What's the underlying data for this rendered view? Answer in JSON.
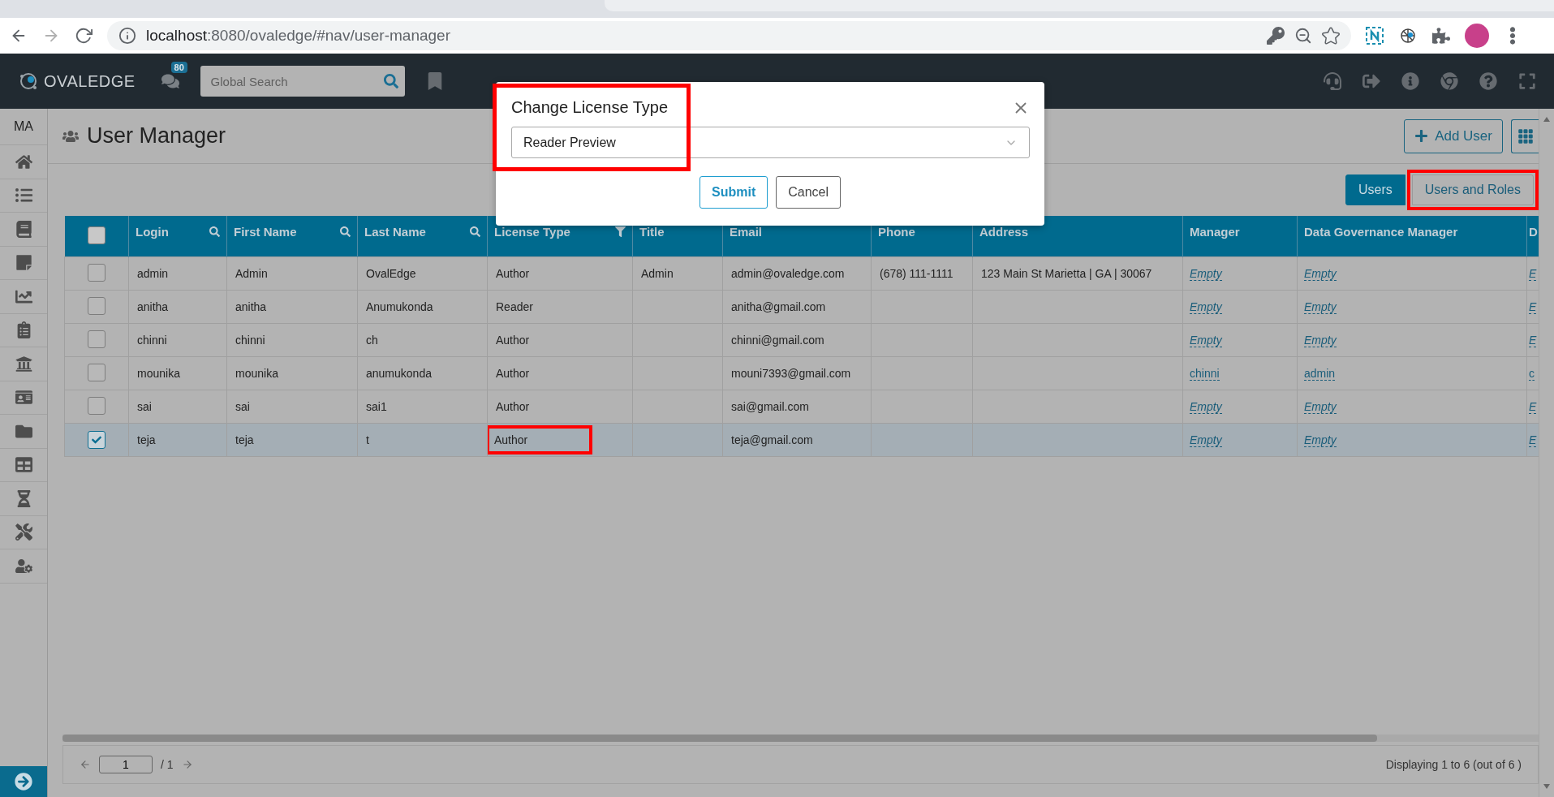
{
  "browser": {
    "url_host": "localhost",
    "url_path": ":8080/ovaledge/#nav/user-manager"
  },
  "app_header": {
    "logo": "OVALEDGE",
    "notification_count": "80",
    "search": {
      "placeholder": "Global Search"
    }
  },
  "sidebar": {
    "user_initials": "MA"
  },
  "page": {
    "title": "User Manager",
    "add_button": "Add User",
    "view_tabs": [
      {
        "label": "Users",
        "selected": true,
        "highlighted": false
      },
      {
        "label": "Users and Roles",
        "selected": false,
        "highlighted": true
      }
    ]
  },
  "table": {
    "select_all": {
      "checked": false
    },
    "columns": [
      {
        "label": "Login",
        "kind": "searchable"
      },
      {
        "label": "First Name",
        "kind": "searchable"
      },
      {
        "label": "Last Name",
        "kind": "searchable"
      },
      {
        "label": "License Type",
        "kind": "filterable"
      },
      {
        "label": "Title"
      },
      {
        "label": "Email"
      },
      {
        "label": "Phone"
      },
      {
        "label": "Address"
      },
      {
        "label": "Manager"
      },
      {
        "label": "Data Governance Manager"
      },
      {
        "label": "D"
      }
    ],
    "rows": [
      {
        "selected": false,
        "cells": [
          {
            "text": "admin"
          },
          {
            "text": "Admin"
          },
          {
            "text": "OvalEdge"
          },
          {
            "text": "Author"
          },
          {
            "text": "Admin"
          },
          {
            "text": "admin@ovaledge.com"
          },
          {
            "text": "(678) 111-1111"
          },
          {
            "text": "123 Main St Marietta | GA | 30067"
          },
          {
            "text": "Empty",
            "kind": "empty"
          },
          {
            "text": "Empty",
            "kind": "empty"
          },
          {
            "text": "E",
            "kind": "empty"
          }
        ]
      },
      {
        "selected": false,
        "cells": [
          {
            "text": "anitha"
          },
          {
            "text": "anitha"
          },
          {
            "text": "Anumukonda"
          },
          {
            "text": "Reader"
          },
          {},
          {
            "text": "anitha@gmail.com"
          },
          {},
          {},
          {
            "text": "Empty",
            "kind": "empty"
          },
          {
            "text": "Empty",
            "kind": "empty"
          },
          {
            "text": "E",
            "kind": "empty"
          }
        ]
      },
      {
        "selected": false,
        "cells": [
          {
            "text": "chinni"
          },
          {
            "text": "chinni"
          },
          {
            "text": "ch"
          },
          {
            "text": "Author"
          },
          {},
          {
            "text": "chinni@gmail.com"
          },
          {},
          {},
          {
            "text": "Empty",
            "kind": "empty"
          },
          {
            "text": "Empty",
            "kind": "empty"
          },
          {
            "text": "E",
            "kind": "empty"
          }
        ]
      },
      {
        "selected": false,
        "cells": [
          {
            "text": "mounika"
          },
          {
            "text": "mounika"
          },
          {
            "text": "anumukonda"
          },
          {
            "text": "Author"
          },
          {},
          {
            "text": "mouni7393@gmail.com"
          },
          {},
          {},
          {
            "text": "chinni",
            "kind": "link"
          },
          {
            "text": "admin",
            "kind": "link"
          },
          {
            "text": "c",
            "kind": "link"
          }
        ]
      },
      {
        "selected": false,
        "cells": [
          {
            "text": "sai"
          },
          {
            "text": "sai"
          },
          {
            "text": "sai1"
          },
          {
            "text": "Author"
          },
          {},
          {
            "text": "sai@gmail.com"
          },
          {},
          {},
          {
            "text": "Empty",
            "kind": "empty"
          },
          {
            "text": "Empty",
            "kind": "empty"
          },
          {
            "text": "E",
            "kind": "empty"
          }
        ]
      },
      {
        "selected": true,
        "cells": [
          {
            "text": "teja"
          },
          {
            "text": "teja"
          },
          {
            "text": "t"
          },
          {
            "text": "Author",
            "highlighted": true
          },
          {},
          {
            "text": "teja@gmail.com"
          },
          {},
          {},
          {
            "text": "Empty",
            "kind": "empty"
          },
          {
            "text": "Empty",
            "kind": "empty"
          },
          {
            "text": "E",
            "kind": "empty"
          }
        ]
      }
    ]
  },
  "pager": {
    "page": "1",
    "total": "/ 1",
    "status": "Displaying 1 to 6 (out of 6 )"
  },
  "dialog": {
    "title": "Change License Type",
    "highlighted": true,
    "value": "Reader Preview",
    "buttons": [
      {
        "label": "Submit",
        "kind": "primary"
      },
      {
        "label": "Cancel",
        "kind": "secondary"
      }
    ]
  }
}
